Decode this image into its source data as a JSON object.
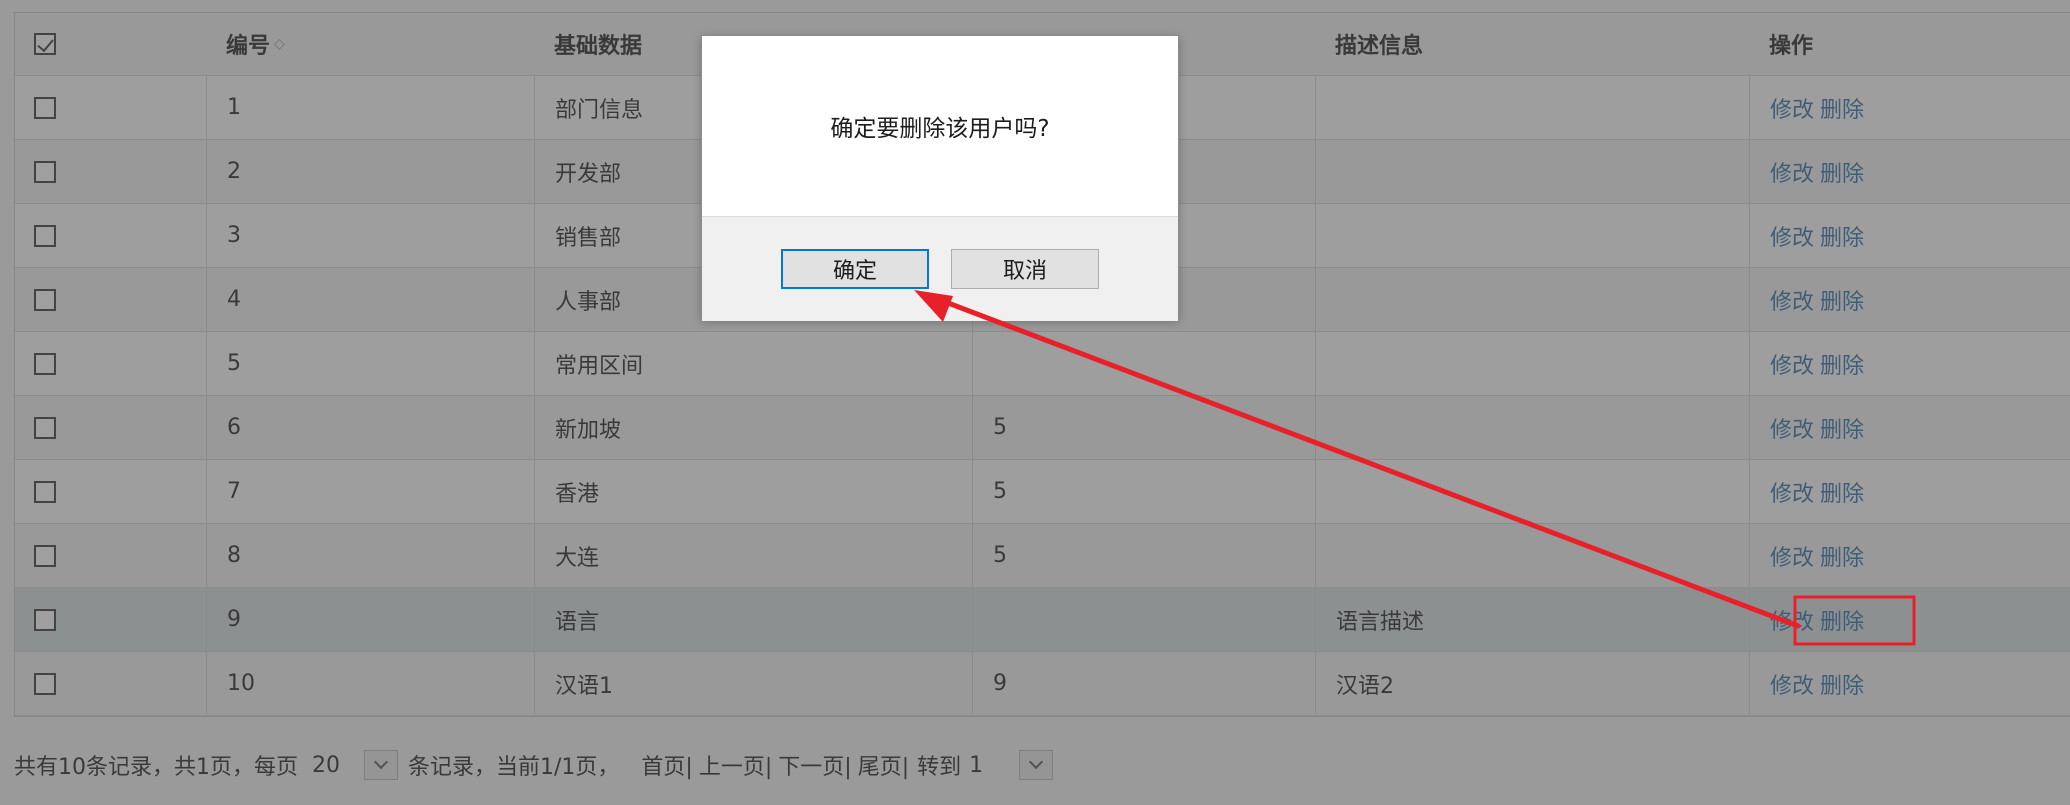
{
  "table": {
    "headers": {
      "select_all_checked": true,
      "id": "编号",
      "name": "基础数据",
      "value": "",
      "description": "描述信息",
      "actions": "操作"
    },
    "rows": [
      {
        "id": "1",
        "name": "部门信息",
        "value": "",
        "description": ""
      },
      {
        "id": "2",
        "name": "开发部",
        "value": "",
        "description": ""
      },
      {
        "id": "3",
        "name": "销售部",
        "value": "",
        "description": ""
      },
      {
        "id": "4",
        "name": "人事部",
        "value": "",
        "description": ""
      },
      {
        "id": "5",
        "name": "常用区间",
        "value": "",
        "description": ""
      },
      {
        "id": "6",
        "name": "新加坡",
        "value": "5",
        "description": ""
      },
      {
        "id": "7",
        "name": "香港",
        "value": "5",
        "description": ""
      },
      {
        "id": "8",
        "name": "大连",
        "value": "5",
        "description": ""
      },
      {
        "id": "9",
        "name": "语言",
        "value": "",
        "description": "语言描述"
      },
      {
        "id": "10",
        "name": "汉语1",
        "value": "9",
        "description": "汉语2"
      }
    ],
    "edit_label": "修改",
    "delete_label": "删除"
  },
  "pager": {
    "summary": "共有10条记录，共1页，每页",
    "page_size": "20",
    "records_current": "条记录，当前1/1页，",
    "first": "首页|",
    "prev": "上一页|",
    "next": "下一页|",
    "last": "尾页|",
    "goto_label": "转到",
    "goto_value": "1"
  },
  "dialog": {
    "message": "确定要删除该用户吗?",
    "confirm": "确定",
    "cancel": "取消"
  },
  "colors": {
    "link": "#2a6ea6",
    "annotation": "#e8202a",
    "primary_border": "#0078d7"
  }
}
